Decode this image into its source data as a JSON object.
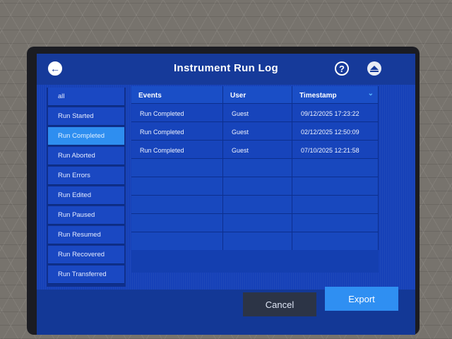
{
  "header": {
    "title": "Instrument Run Log",
    "back_icon": "arrow-left-icon",
    "help_label": "?",
    "eject_icon": "eject-icon"
  },
  "sidebar": {
    "items": [
      {
        "label": "all"
      },
      {
        "label": "Run Started"
      },
      {
        "label": "Run Completed",
        "selected": true
      },
      {
        "label": "Run Aborted"
      },
      {
        "label": "Run Errors"
      },
      {
        "label": "Run Edited"
      },
      {
        "label": "Run Paused"
      },
      {
        "label": "Run Resumed"
      },
      {
        "label": "Run Recovered"
      },
      {
        "label": "Run Transferred"
      }
    ]
  },
  "table": {
    "columns": [
      "Events",
      "User",
      "Timestamp"
    ],
    "sort_icon": "chevron-down-icon",
    "rows": [
      {
        "event": "Run Completed",
        "user": "Guest",
        "timestamp": "09/12/2025 17:23:22"
      },
      {
        "event": "Run Completed",
        "user": "Guest",
        "timestamp": "02/12/2025 12:50:09"
      },
      {
        "event": "Run Completed",
        "user": "Guest",
        "timestamp": "07/10/2025 12:21:58"
      }
    ]
  },
  "footer": {
    "cancel_label": "Cancel",
    "export_label": "Export"
  },
  "colors": {
    "screen_bg": "#1641b8",
    "selected_item": "#2e8ef0",
    "export_button": "#2f8ff2",
    "cancel_button": "#2c3446"
  }
}
